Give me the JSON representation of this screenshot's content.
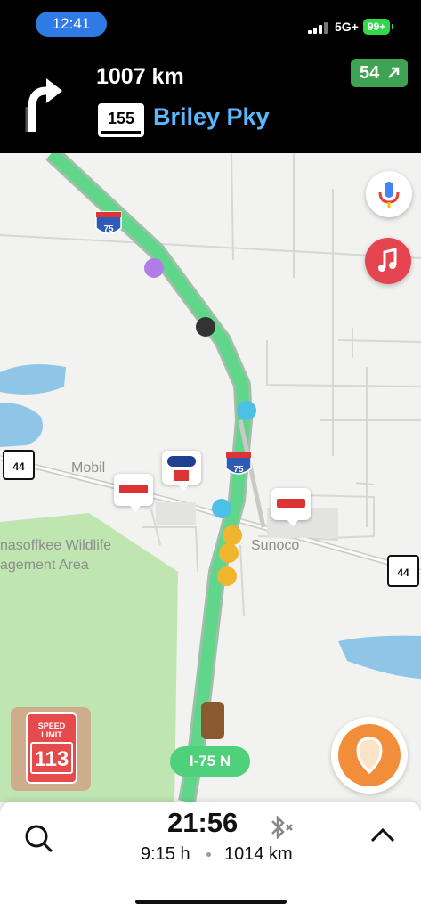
{
  "status_bar": {
    "time": "12:41",
    "network": "5G+",
    "battery": "99+"
  },
  "nav": {
    "distance": "1007 km",
    "route_shield": "155",
    "street": "Briley Pky",
    "speed": "54"
  },
  "map": {
    "labels": {
      "mobil": "Mobil",
      "sunoco": "Sunoco",
      "wildlife_line1": "nasoffkee Wildlife",
      "wildlife_line2": "agement Area"
    },
    "shields": {
      "i75_top": "75",
      "i75_mid": "75",
      "sr44_left": "44",
      "sr44_right": "44"
    },
    "road_name": "I-75 N",
    "speed_limit": {
      "line1": "SPEED",
      "line2": "LIMIT",
      "value": "113"
    }
  },
  "bottom": {
    "eta": "21:56",
    "duration": "9:15 h",
    "distance": "1014 km"
  },
  "colors": {
    "route": "#5fd68a",
    "accent": "#2f7ae5",
    "street": "#5bb8ff",
    "water": "#8fc6e8",
    "park": "#bfe5b1"
  }
}
